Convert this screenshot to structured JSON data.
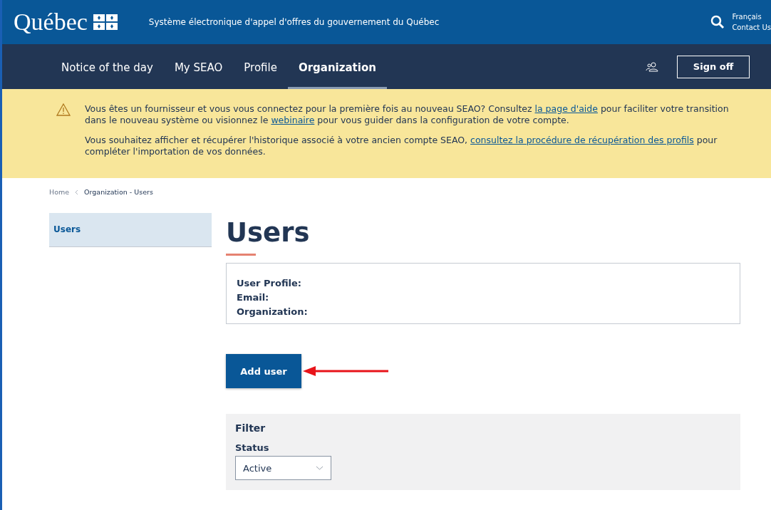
{
  "header": {
    "logo": "Québec",
    "title": "Système électronique d'appel d'offres du gouvernement du Québec",
    "links": [
      "Français",
      "Contact Us"
    ]
  },
  "nav": {
    "items": [
      {
        "label": "Notice of the day",
        "selected": false
      },
      {
        "label": "My SEAO",
        "selected": false
      },
      {
        "label": "Profile",
        "selected": false
      },
      {
        "label": "Organization",
        "selected": true
      }
    ],
    "sign_off": "Sign off"
  },
  "alert": {
    "paragraphs": [
      [
        {
          "kind": "text",
          "text": "Vous êtes un fournisseur et vous vous connectez pour la première fois au nouveau SEAO? Consultez "
        },
        {
          "kind": "link",
          "text": "la page d'aide"
        },
        {
          "kind": "text",
          "text": " pour faciliter votre transition dans le nouveau système ou visionnez le "
        },
        {
          "kind": "link",
          "text": "webinaire"
        },
        {
          "kind": "text",
          "text": " pour vous guider dans la configuration de votre compte."
        }
      ],
      [
        {
          "kind": "text",
          "text": "Vous souhaitez afficher et récupérer l'historique associé à votre ancien compte SEAO, "
        },
        {
          "kind": "link",
          "text": "consultez la procédure de récupération des profils"
        },
        {
          "kind": "text",
          "text": " pour compléter l'importation de vos données."
        }
      ]
    ]
  },
  "breadcrumb": [
    "Home",
    "Organization - Users"
  ],
  "sidebar": {
    "items": [
      {
        "label": "Users",
        "selected": true
      }
    ]
  },
  "page_title": "Users",
  "info": [
    "User Profile:",
    "Email:",
    "Organization:"
  ],
  "add_user": "Add user",
  "filter": {
    "title": "Filter",
    "status_label": "Status",
    "status_value": "Active"
  }
}
